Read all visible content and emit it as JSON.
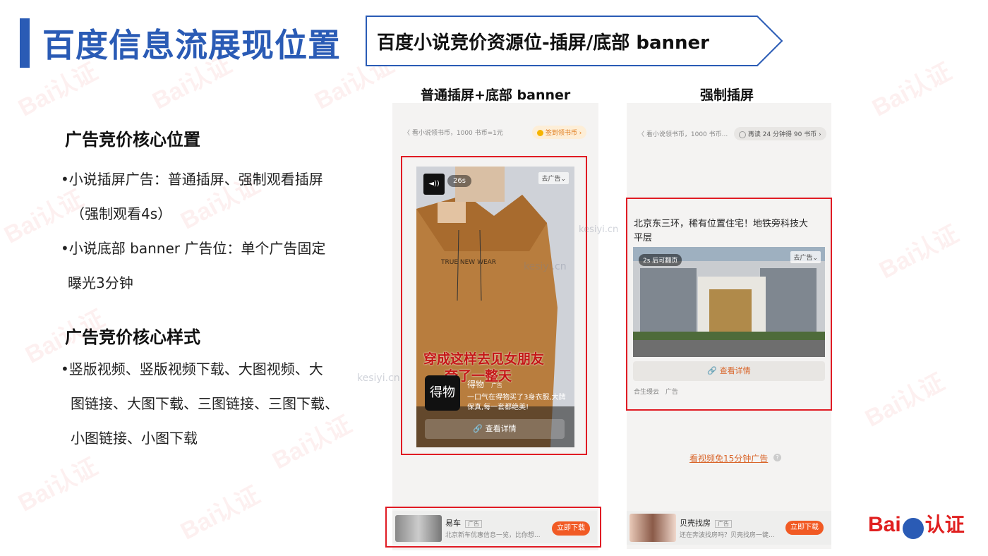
{
  "page": {
    "title": "百度信息流展现位置",
    "banner": "百度小说竞价资源位-插屏/底部 banner"
  },
  "left": {
    "core_position_heading": "广告竞价核心位置",
    "bullet1_line1": "•小说插屏广告：普通插屏、强制观看插屏",
    "bullet1_line2": "（强制观看4s）",
    "bullet2_line1": "•小说底部 banner 广告位：单个广告固定",
    "bullet2_line2": "曝光3分钟",
    "core_style_heading": "广告竞价核心样式",
    "styles_line1": "•竖版视频、竖版视频下载、大图视频、大",
    "styles_line2": "图链接、大图下载、三图链接、三图下载、",
    "styles_line3": "小图链接、小图下载"
  },
  "phone1": {
    "label": "普通插屏+底部 banner",
    "topline": "〈 看小说领书币，1000 书币=1元",
    "signin_pill": "签到领书币 ›",
    "timer": "26s",
    "close_ad": "去广告⌄",
    "overlay_line1": "穿成这样去见女朋友",
    "overlay_line2": "夸了一整天",
    "brand_logo": "得物",
    "brand_name": "得物",
    "ad_tag": "广告",
    "desc_line1": "一口气在得物买了3身衣服,大牌",
    "desc_line2": "保真,每一套都绝美!",
    "detail_button": "查看详情",
    "banner_name": "易车",
    "banner_tag": "广告",
    "banner_desc": "北京新车优惠信息一览，比你想...",
    "banner_button": "立即下载"
  },
  "phone2": {
    "label": "强制插屏",
    "topline": "〈 看小说领书币，1000 书币...",
    "read_pill": "再读 24 分钟得 90 书币 ›",
    "headline_line1": "北京东三环，稀有位置住宅！地铁旁科技大",
    "headline_line2": "平层",
    "flip_badge": "2s 后可翻页",
    "close_ad": "去广告⌄",
    "detail_button": "查看详情",
    "source": "合生缦云",
    "ad_tag": "广告",
    "video_link": "看视频免15分钟广告",
    "banner_name": "贝壳找房",
    "banner_tag": "广告",
    "banner_desc": "还在奔波找房吗？贝壳找房一键...",
    "banner_button": "立即下载"
  },
  "watermark": {
    "site": "kesiyi.cn",
    "brand": "Bai认证",
    "logo_text_1": "Bai",
    "logo_text_2": "认证"
  },
  "colors": {
    "title_blue": "#2a5bb5",
    "frame_red": "#e01b24",
    "button_orange": "#f15a24",
    "link_orange": "#d9652a"
  }
}
